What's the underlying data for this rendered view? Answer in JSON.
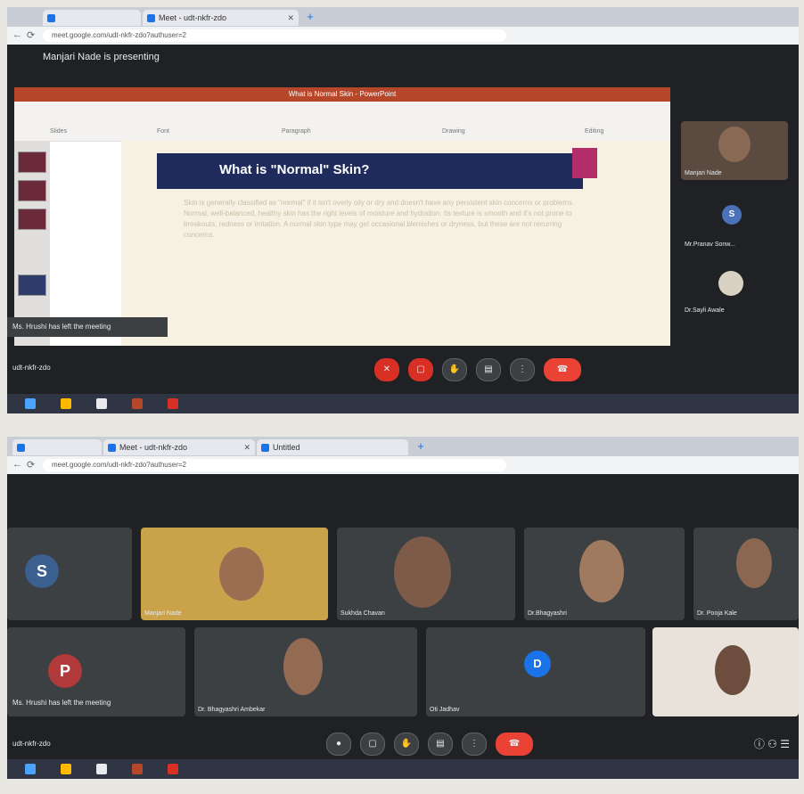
{
  "shot1": {
    "tabs": [
      {
        "label": ""
      },
      {
        "label": "Meet - udt-nkfr-zdo"
      }
    ],
    "url": "meet.google.com/udt-nkfr-zdo?authuser=2",
    "presenter_banner": "Manjari Nade is presenting",
    "ppt": {
      "window_title": "What is Normal Skin - PowerPoint",
      "groups": [
        "Slides",
        "Font",
        "Paragraph",
        "Drawing",
        "Editing"
      ],
      "slide_title": "What is \"Normal\" Skin?",
      "slide_text": "Skin is generally classified as \"normal\" if it isn't overly oily or dry and doesn't have any persistent skin concerns or problems. Normal, well-balanced, healthy skin has the right levels of moisture and hydration. Its texture is smooth and it's not prone to breakouts, redness or irritation. A normal skin type may get occasional blemishes or dryness, but these are not recurring concerns."
    },
    "participants": [
      {
        "name": "Manjari Nade",
        "kind": "video"
      },
      {
        "name": "Mr.Pranav Sonw...",
        "kind": "avatar",
        "initial": "S"
      },
      {
        "name": "Dr.Sayli Awale",
        "kind": "photo"
      }
    ],
    "left_message": "Ms. Hrushi has left the meeting",
    "meeting_code": "udt-nkfr-zdo",
    "controls": [
      "mic",
      "camera",
      "hand",
      "captions",
      "more",
      "end"
    ]
  },
  "shot2": {
    "tabs": [
      {
        "label": ""
      },
      {
        "label": "Meet - udt-nkfr-zdo"
      },
      {
        "label": "Untitled"
      }
    ],
    "url": "meet.google.com/udt-nkfr-zdo?authuser=2",
    "tiles": [
      {
        "name": "",
        "kind": "avatar",
        "initial": "S",
        "color": "#3b5f8f"
      },
      {
        "name": "Manjari Nade",
        "kind": "video"
      },
      {
        "name": "Sukhda Chavan",
        "kind": "video"
      },
      {
        "name": "Dr.Bhagyashri",
        "kind": "video"
      },
      {
        "name": "Dr. Pooja Kale",
        "kind": "video"
      },
      {
        "name": "",
        "kind": "avatar",
        "initial": "P",
        "color": "#b23a3a"
      },
      {
        "name": "Dr. Bhagyashri Ambekar",
        "kind": "video"
      },
      {
        "name": "Oti Jadhav",
        "kind": "avatar",
        "initial": "D",
        "color": "#1a73e8"
      },
      {
        "name": "",
        "kind": "video"
      }
    ],
    "left_message": "Ms. Hrushi has left the meeting",
    "meeting_code": "udt-nkfr-zdo",
    "controls": [
      "mic",
      "camera",
      "hand",
      "captions",
      "more",
      "end"
    ]
  },
  "colors": {
    "meet_bg": "#202124",
    "tile_bg": "#3c4043",
    "end_call": "#ea4335",
    "ppt_brand": "#b7472a",
    "slide_band": "#1f2b5c"
  }
}
